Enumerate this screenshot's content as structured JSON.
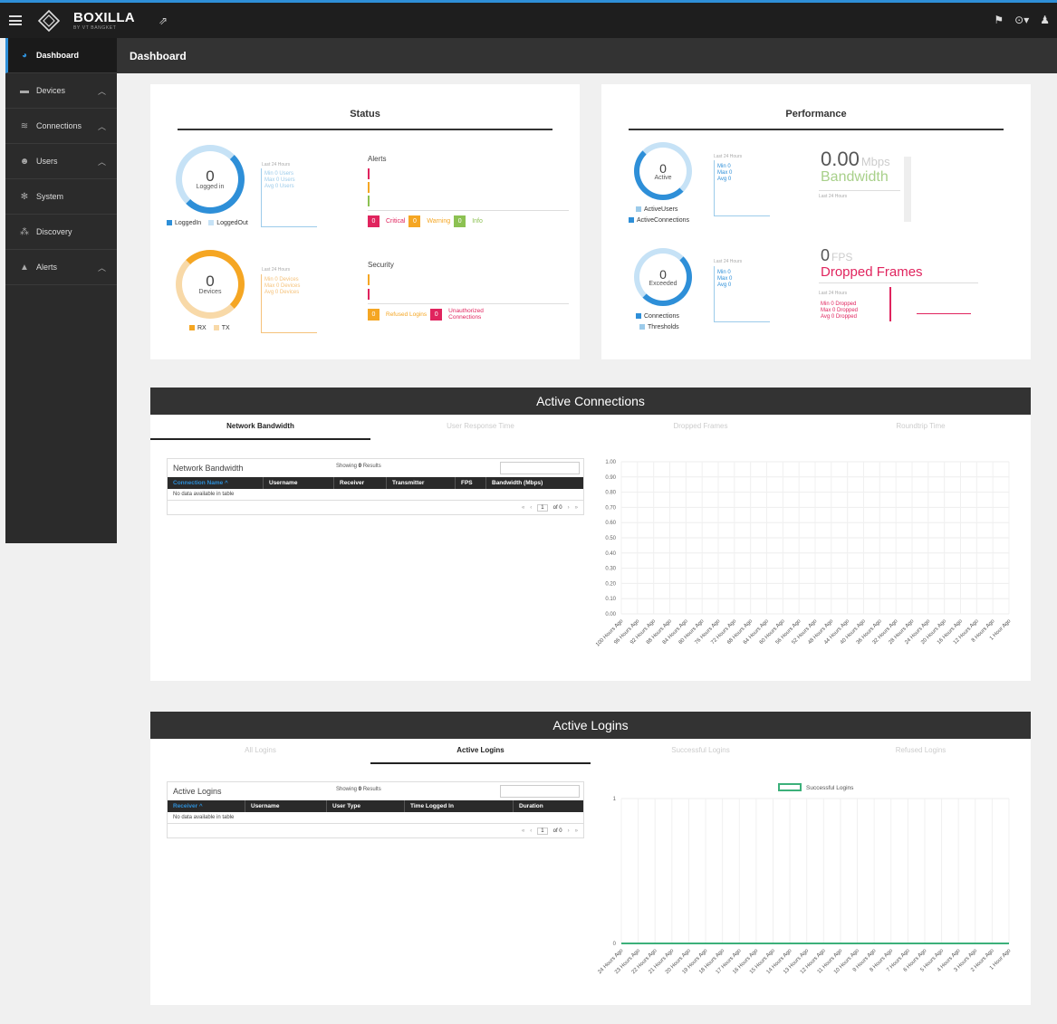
{
  "app": {
    "brand": "BOXILLA",
    "brand_sub": "BY VT BANGKET"
  },
  "sidebar": {
    "items": [
      {
        "label": "Dashboard",
        "icon": "dashboard-icon",
        "active": true
      },
      {
        "label": "Devices",
        "icon": "devices-icon"
      },
      {
        "label": "Connections",
        "icon": "wifi-icon"
      },
      {
        "label": "Users",
        "icon": "users-icon"
      },
      {
        "label": "System",
        "icon": "gear-icon"
      },
      {
        "label": "Discovery",
        "icon": "discovery-icon"
      },
      {
        "label": "Alerts",
        "icon": "warning-icon"
      }
    ]
  },
  "header": {
    "title": "Dashboard"
  },
  "status": {
    "title": "Status",
    "logged": {
      "value": "0",
      "label": "Logged in",
      "last": "Last 24 Hours",
      "min": "Min 0 Users",
      "max": "Max 0 Users",
      "avg": "Avg 0 Users",
      "legend_a": "LoggedIn",
      "legend_b": "LoggedOut"
    },
    "devices": {
      "value": "0",
      "label": "Devices",
      "last": "Last 24 Hours",
      "min": "Min 0 Devices",
      "max": "Max 0 Devices",
      "avg": "Avg 0 Devices",
      "legend_a": "RX",
      "legend_b": "TX"
    },
    "alerts": {
      "title": "Alerts",
      "critical_count": "0",
      "critical": "Critical",
      "warning_count": "0",
      "warning": "Warning",
      "info_count": "0",
      "info": "Info"
    },
    "security": {
      "title": "Security",
      "refused_count": "0",
      "refused": "Refused Logins",
      "unauth_count": "0",
      "unauth": "Unauthorized Connections"
    }
  },
  "performance": {
    "title": "Performance",
    "active": {
      "value": "0",
      "label": "Active",
      "last": "Last 24 Hours",
      "min": "Min 0",
      "max": "Max 0",
      "avg": "Avg 0",
      "legend_a": "ActiveUsers",
      "legend_b": "ActiveConnections"
    },
    "bandwidth": {
      "value": "0.00",
      "unit": "Mbps",
      "label": "Bandwidth",
      "last": "Last 24 Hours"
    },
    "exceeded": {
      "value": "0",
      "label": "Exceeded",
      "last": "Last 24 Hours",
      "min": "Min 0",
      "max": "Max 0",
      "avg": "Avg 0",
      "legend_a": "Connections",
      "legend_b": "Thresholds"
    },
    "fps": {
      "value": "0",
      "unit": "FPS",
      "label": "Dropped Frames",
      "last": "Last 24 Hours",
      "min": "Min 0 Dropped",
      "max": "Max 0 Dropped",
      "avg": "Avg 0 Dropped"
    }
  },
  "active_connections": {
    "title": "Active Connections",
    "tabs": [
      "Network Bandwidth",
      "User Response Time",
      "Dropped Frames",
      "Roundtrip Time"
    ],
    "active_tab": 0,
    "table": {
      "title": "Network Bandwidth",
      "showing_prefix": "Showing",
      "showing_count": "0",
      "showing_suffix": "Results",
      "columns": [
        "Connection Name ^",
        "Username",
        "Receiver",
        "Transmitter",
        "FPS",
        "Bandwidth (Mbps)"
      ],
      "empty": "No data available in table",
      "page": "1",
      "of": "of 0"
    }
  },
  "active_logins": {
    "title": "Active Logins",
    "tabs": [
      "All Logins",
      "Active Logins",
      "Successful Logins",
      "Refused Logins"
    ],
    "active_tab": 1,
    "table": {
      "title": "Active Logins",
      "showing_prefix": "Showing",
      "showing_count": "0",
      "showing_suffix": "Results",
      "columns": [
        "Receiver ^",
        "Username",
        "User Type",
        "Time Logged In",
        "Duration"
      ],
      "empty": "No data available in table",
      "page": "1",
      "of": "of 0"
    }
  },
  "chart_data": [
    {
      "type": "line",
      "categories": [
        "100 Hours Ago",
        "96 Hours Ago",
        "92 Hours Ago",
        "88 Hours Ago",
        "84 Hours Ago",
        "80 Hours Ago",
        "76 Hours Ago",
        "72 Hours Ago",
        "68 Hours Ago",
        "64 Hours Ago",
        "60 Hours Ago",
        "56 Hours Ago",
        "52 Hours Ago",
        "48 Hours Ago",
        "44 Hours Ago",
        "40 Hours Ago",
        "36 Hours Ago",
        "32 Hours Ago",
        "28 Hours Ago",
        "24 Hours Ago",
        "20 Hours Ago",
        "16 Hours Ago",
        "12 Hours Ago",
        "8 Hours Ago",
        "1 Hour Ago"
      ],
      "series": [],
      "yticks": [
        "1.00",
        "0.90",
        "0.80",
        "0.70",
        "0.60",
        "0.50",
        "0.40",
        "0.30",
        "0.20",
        "0.10",
        "0.00"
      ],
      "ylim": [
        0,
        1
      ],
      "grid": true
    },
    {
      "type": "line",
      "categories": [
        "24 Hours Ago",
        "23 Hours Ago",
        "22 Hours Ago",
        "21 Hours Ago",
        "20 Hours Ago",
        "19 Hours Ago",
        "18 Hours Ago",
        "17 Hours Ago",
        "16 Hours Ago",
        "15 Hours Ago",
        "14 Hours Ago",
        "13 Hours Ago",
        "12 Hours Ago",
        "11 Hours Ago",
        "10 Hours Ago",
        "9 Hours Ago",
        "8 Hours Ago",
        "7 Hours Ago",
        "6 Hours Ago",
        "5 Hours Ago",
        "4 Hours Ago",
        "3 Hours Ago",
        "2 Hours Ago",
        "1 Hour Ago"
      ],
      "series": [
        {
          "name": "Successful Logins",
          "values": [
            0,
            0,
            0,
            0,
            0,
            0,
            0,
            0,
            0,
            0,
            0,
            0,
            0,
            0,
            0,
            0,
            0,
            0,
            0,
            0,
            0,
            0,
            0,
            0
          ],
          "color": "#3cb07a"
        }
      ],
      "yticks": [
        "1",
        "0"
      ],
      "ylim": [
        0,
        1
      ],
      "legend": "top-center",
      "grid": true
    }
  ],
  "colors": {
    "blue": "#2e8fd8",
    "light_blue": "#9ccbea",
    "orange": "#f5a623",
    "light_orange": "#f8d9a8",
    "red": "#e0245e",
    "green": "#8cc152",
    "login_green": "#3cb07a"
  }
}
